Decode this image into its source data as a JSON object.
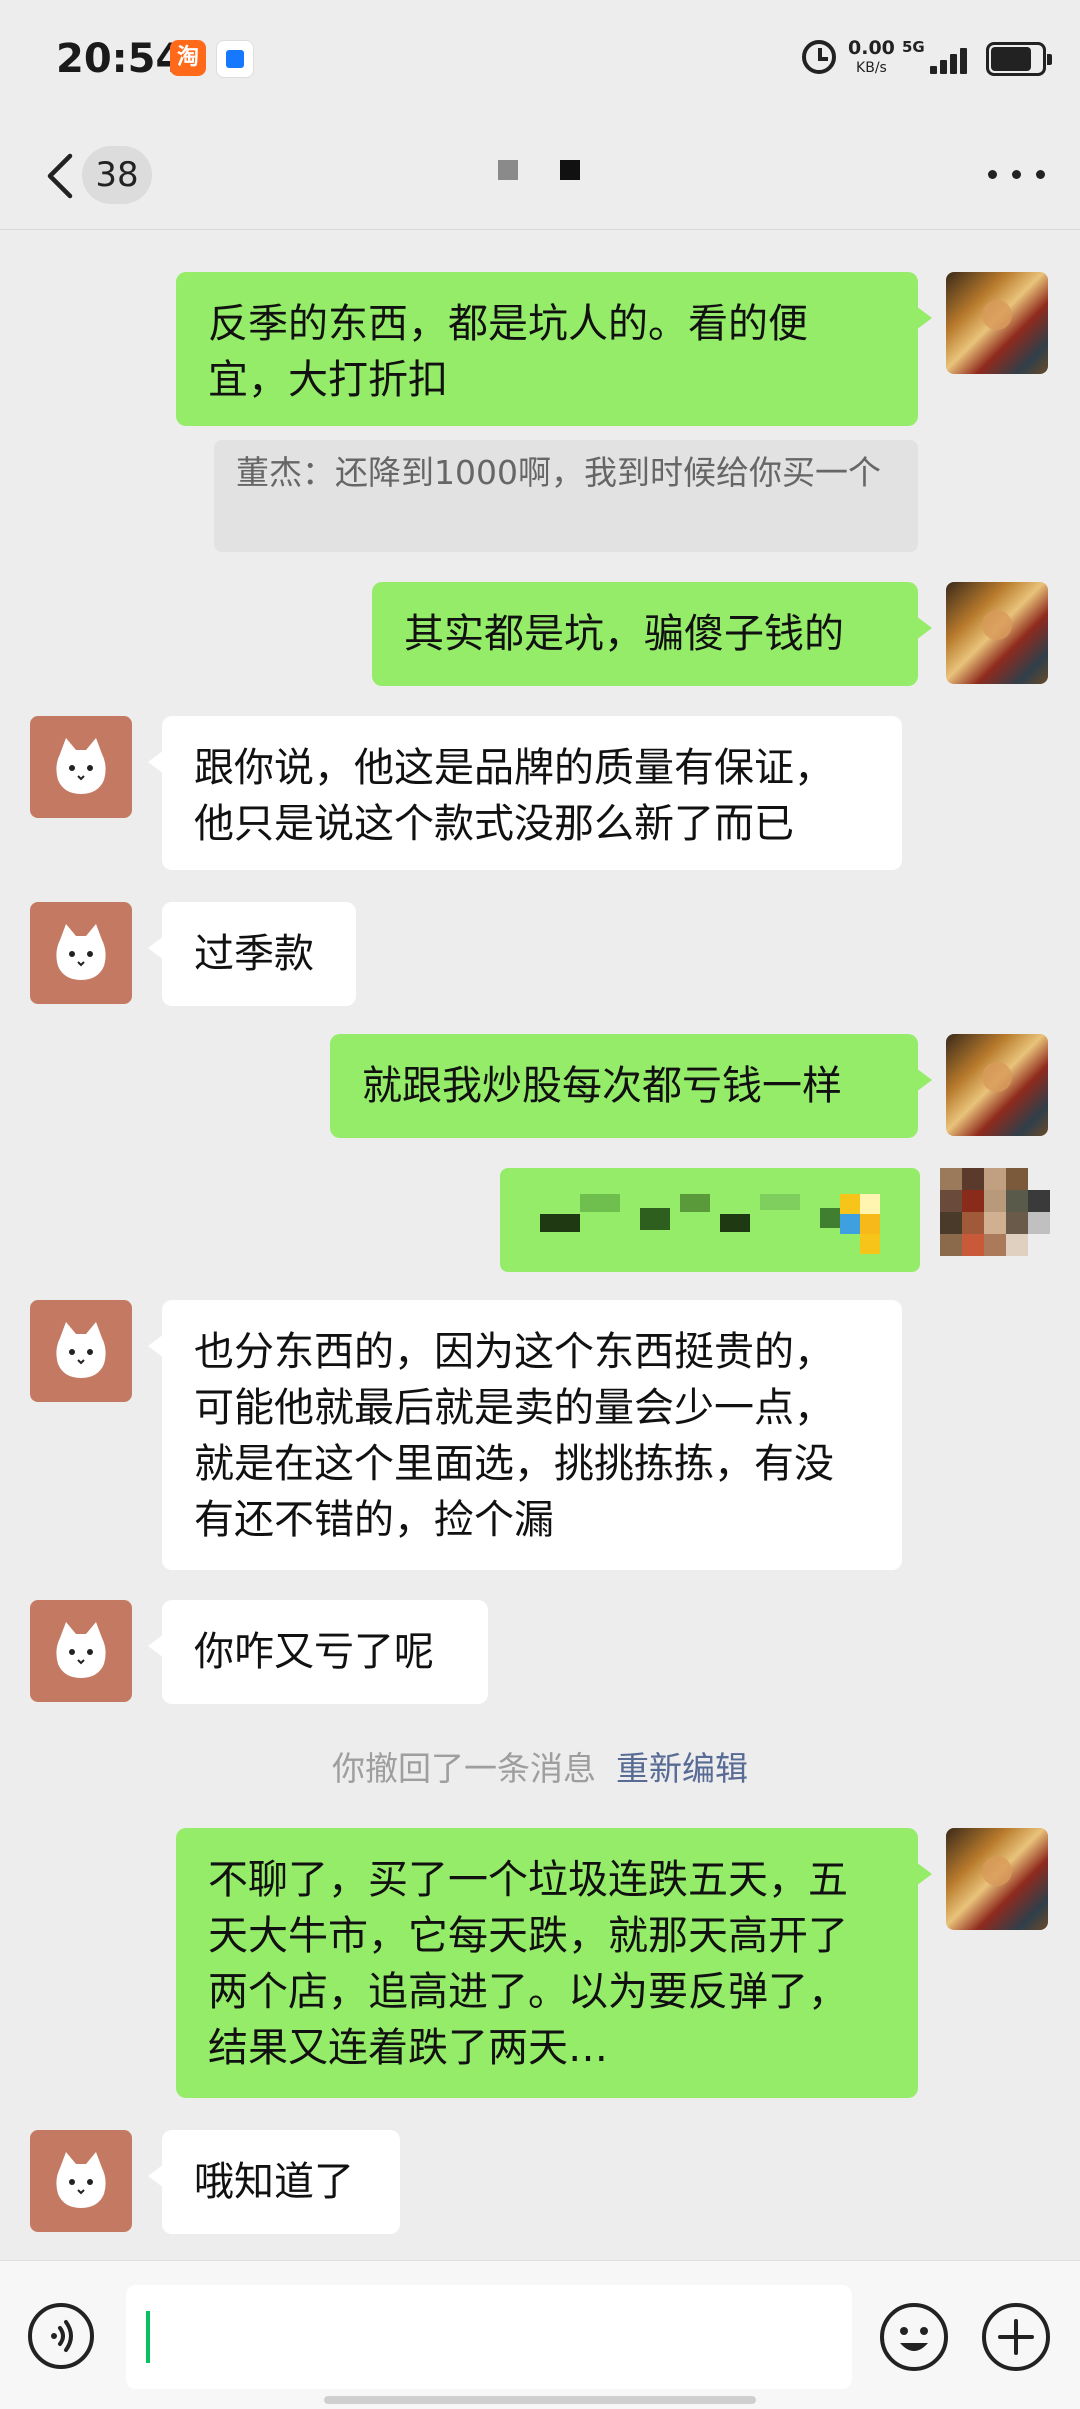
{
  "status_bar": {
    "time": "20:54",
    "app_icons": [
      "淘",
      "blue-app-icon"
    ],
    "net_speed": "0.00",
    "net_unit": "KB/s",
    "network": "5G"
  },
  "header": {
    "unread_count": "38"
  },
  "quote": {
    "text": "董杰：还降到1000啊，我到时候给你买一个"
  },
  "messages": [
    {
      "side": "me",
      "text": "反季的东西，都是坑人的。看的便宜，大打折扣"
    },
    {
      "side": "me",
      "text": "其实都是坑，骗傻子钱的"
    },
    {
      "side": "other",
      "text": "跟你说，他这是品牌的质量有保证，他只是说这个款式没那么新了而已"
    },
    {
      "side": "other",
      "text": "过季款"
    },
    {
      "side": "me",
      "text": "就跟我炒股每次都亏钱一样"
    },
    {
      "side": "other",
      "text": "也分东西的，因为这个东西挺贵的，可能他就最后就是卖的量会少一点，就是在这个里面选，挑挑拣拣，有没有还不错的，捡个漏"
    },
    {
      "side": "other",
      "text": "你咋又亏了呢"
    },
    {
      "side": "me",
      "text": "不聊了，买了一个垃圾连跌五天，五天大牛市，它每天跌，就那天高开了两个店，追高进了。以为要反弹了，结果又连着跌了两天…"
    },
    {
      "side": "other",
      "text": "哦知道了"
    }
  ],
  "recall_notice": {
    "text": "你撤回了一条消息",
    "action": "重新编辑"
  },
  "colors": {
    "my_bubble": "#95ec69",
    "other_bubble": "#ffffff",
    "background": "#ededed",
    "link": "#576b95",
    "cursor": "#07c160"
  }
}
